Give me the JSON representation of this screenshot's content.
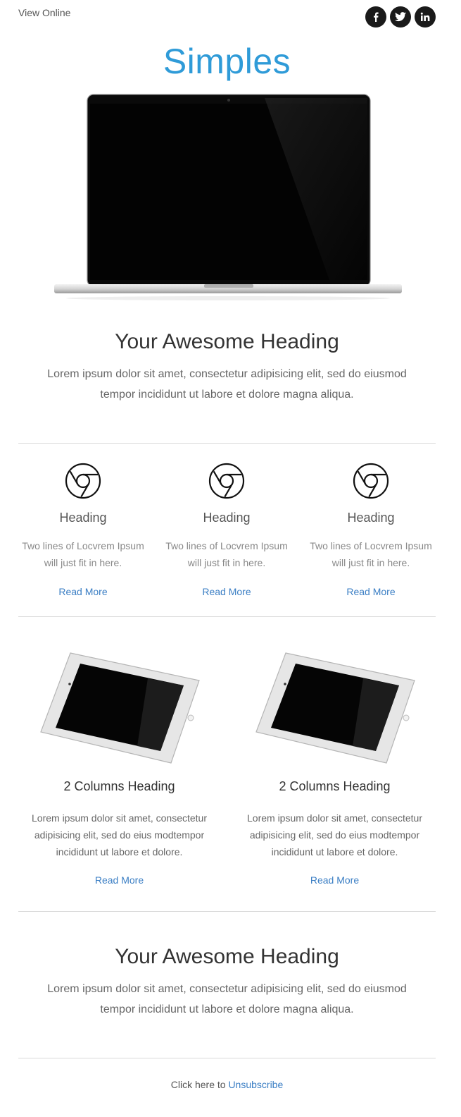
{
  "header": {
    "view_online": "View Online",
    "social": [
      "facebook-icon",
      "twitter-icon",
      "linkedin-icon"
    ]
  },
  "brand": {
    "title": "Simples",
    "color": "#2f9bd8"
  },
  "hero": {
    "heading": "Your Awesome Heading",
    "text": "Lorem ipsum dolor sit amet, consectetur adipisicing elit, sed do eiusmod tempor incididunt ut labore et dolore magna aliqua."
  },
  "features": [
    {
      "icon": "chrome-icon",
      "heading": "Heading",
      "text": "Two lines of Locvrem Ipsum will just fit in here.",
      "link": "Read More"
    },
    {
      "icon": "chrome-icon",
      "heading": "Heading",
      "text": "Two lines of Locvrem Ipsum will just fit in here.",
      "link": "Read More"
    },
    {
      "icon": "chrome-icon",
      "heading": "Heading",
      "text": "Two lines of Locvrem Ipsum will just fit in here.",
      "link": "Read More"
    }
  ],
  "two_columns": [
    {
      "image": "tablet-image",
      "heading": "2 Columns Heading",
      "text": "Lorem ipsum dolor sit amet, consectetur adipisicing elit, sed do eius modtempor incididunt ut labore et dolore.",
      "link": "Read More"
    },
    {
      "image": "tablet-image",
      "heading": "2 Columns Heading",
      "text": "Lorem ipsum dolor sit amet, consectetur adipisicing elit, sed do eius modtempor incididunt ut labore et dolore.",
      "link": "Read More"
    }
  ],
  "closing": {
    "heading": "Your Awesome Heading",
    "text": "Lorem ipsum dolor sit amet, consectetur adipisicing elit, sed do eiusmod tempor incididunt ut labore et dolore magna aliqua."
  },
  "footer": {
    "prefix": "Click here to",
    "unsubscribe": "Unsubscribe"
  },
  "colors": {
    "link": "#3a7ec4",
    "rule": "#d9d9d9",
    "social_bg": "#1a1a1a"
  }
}
